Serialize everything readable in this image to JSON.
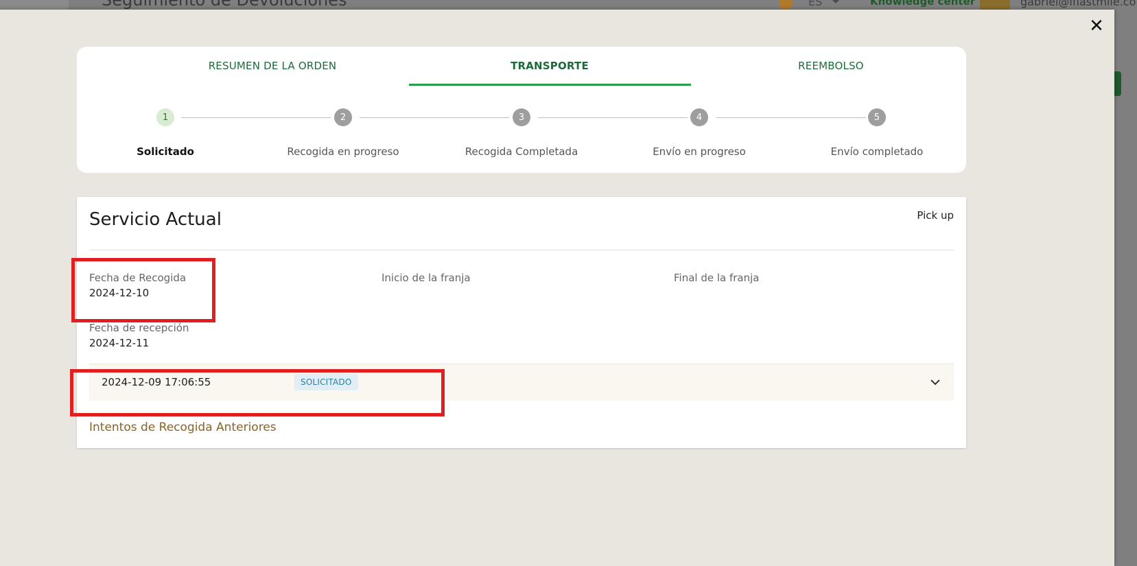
{
  "background": {
    "title": "Seguimiento de Devoluciones",
    "lang": "ES",
    "knowledge_center": "Knowledge center",
    "email": "gabriel@lflastmile.co"
  },
  "tabs": [
    {
      "label": "RESUMEN DE LA ORDEN",
      "active": false
    },
    {
      "label": "TRANSPORTE",
      "active": true
    },
    {
      "label": "REEMBOLSO",
      "active": false
    }
  ],
  "steps": [
    {
      "number": "1",
      "label": "Solicitado",
      "active": true
    },
    {
      "number": "2",
      "label": "Recogida en progreso",
      "active": false
    },
    {
      "number": "3",
      "label": "Recogida Completada",
      "active": false
    },
    {
      "number": "4",
      "label": "Envío en progreso",
      "active": false
    },
    {
      "number": "5",
      "label": "Envío completado",
      "active": false
    }
  ],
  "service": {
    "title": "Servicio Actual",
    "type": "Pick up",
    "fields": {
      "pickup_date_label": "Fecha de Recogida",
      "pickup_date_value": "2024-12-10",
      "slot_start_label": "Inicio de la franja",
      "slot_end_label": "Final de la franja",
      "reception_date_label": "Fecha de recepción",
      "reception_date_value": "2024-12-11"
    },
    "history": {
      "timestamp": "2024-12-09 17:06:55",
      "status": "SOLICITADO"
    },
    "previous_attempts_link": "Intentos de Recogida Anteriores"
  },
  "icons": {
    "close": "close-icon",
    "expand": "chevron-down-icon"
  },
  "colors": {
    "accent_green": "#27a04c",
    "tab_text": "#1b6b3a",
    "badge_bg": "#e2eef3",
    "badge_text": "#2a7fa6",
    "highlight": "#e02020",
    "link": "#8a6324"
  }
}
